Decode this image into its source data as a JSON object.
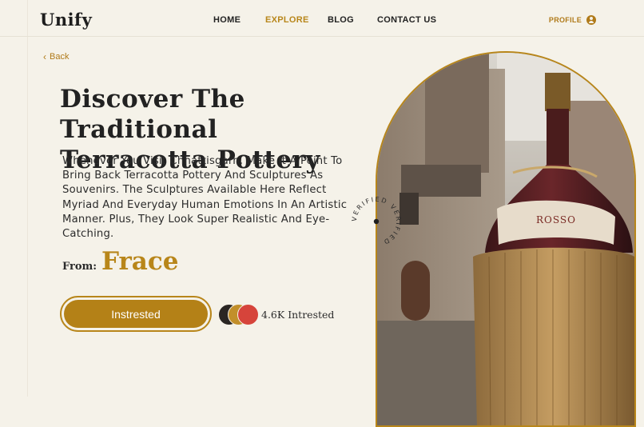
{
  "nav": {
    "logo": "Unify",
    "links": [
      {
        "label": "HOME",
        "active": false
      },
      {
        "label": "EXPLORE",
        "active": true
      },
      {
        "label": "BLOG",
        "active": false
      },
      {
        "label": "CONTACT US",
        "active": false
      }
    ],
    "profile_label": "PROFILE",
    "profile_icon": "user-icon"
  },
  "back": {
    "label": "Back",
    "icon": "chevron-left-icon"
  },
  "hero": {
    "title_line1": "Discover The Traditional",
    "title_line2": "Terracotta Pottery",
    "description": "Whenever You Visit Chhattisgarh, Make It A Point To Bring Back Terracotta Pottery And Sculptures As Souvenirs. The Sculptures Available Here Reflect Myriad And Everyday Human Emotions In An Artistic Manner. Plus, They Look Super Realistic And Eye-Catching.",
    "from_label": "From:",
    "from_value": "Frace"
  },
  "cta": {
    "label": "Instrested"
  },
  "interest": {
    "count_label": "4.6K Intrested",
    "avatar_colors": [
      "#2a2623",
      "#c28f2a",
      "#d6443b"
    ]
  },
  "badge": {
    "text": "VERIFIED VERIFIED"
  },
  "photo": {
    "bottle_label": "ROSSO"
  },
  "colors": {
    "accent": "#b8861a",
    "background": "#f5f2e9"
  }
}
